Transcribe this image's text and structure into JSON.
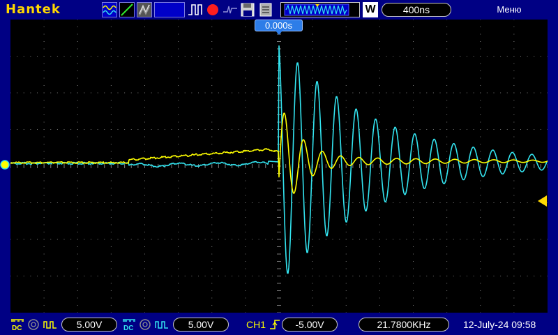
{
  "app": {
    "brand": "Hantek",
    "menu_label": "Меню"
  },
  "toolbar": {
    "timebase": "400ns",
    "acquire_mode_letter": "W",
    "icons": [
      "waveform-view-icon",
      "ramp-icon",
      "persistence-icon",
      "blank-field",
      "pulse-trigger-icon",
      "record-icon",
      "trigger-slope-icon",
      "save-icon",
      "file-list-icon",
      "memory-waveform-icon"
    ]
  },
  "trigger": {
    "time_position": "0.000s",
    "channel": "CH1",
    "level": "-5.00V",
    "frequency": "21.7800KHz",
    "slope_icon": "rising-edge-icon"
  },
  "channels": [
    {
      "name": "CH1",
      "coupling": "DC",
      "volts_per_div": "5.00V",
      "color": "#ffff00"
    },
    {
      "name": "CH2",
      "coupling": "DC",
      "volts_per_div": "5.00V",
      "color": "#00e5ff"
    }
  ],
  "status": {
    "datetime": "12-July-24 09:58"
  },
  "colors": {
    "background": "#000084",
    "screen": "#000000",
    "grid": "#7a7a7a",
    "ch1": "#ffff00",
    "ch2": "#33e4f0",
    "trigger_marker": "#ffd800"
  }
}
